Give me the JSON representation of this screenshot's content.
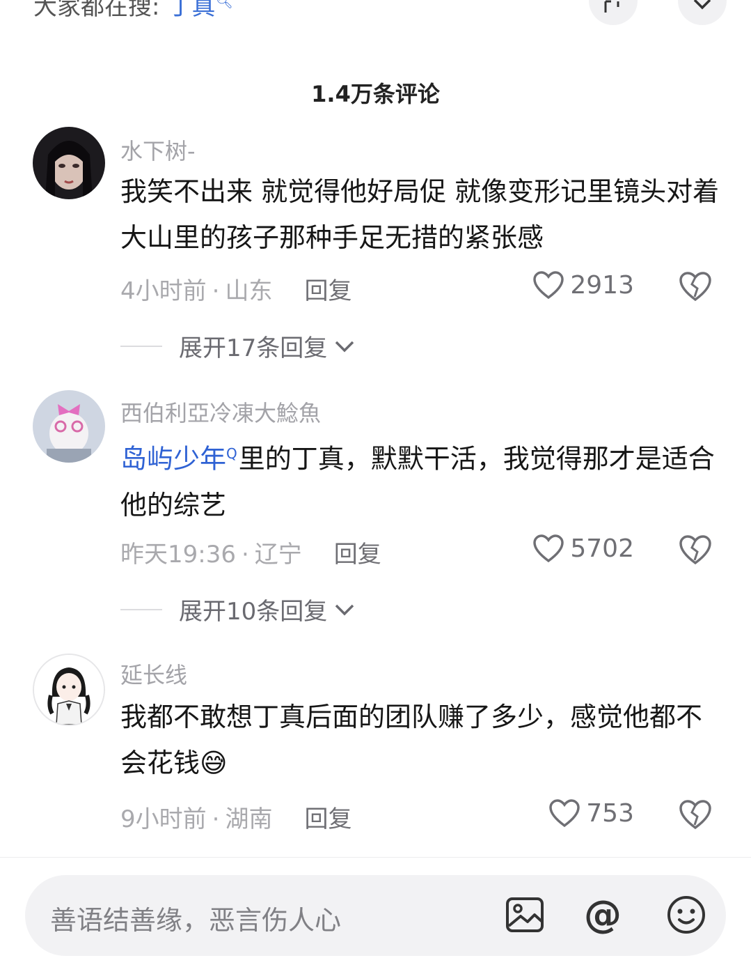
{
  "topbar": {
    "search_hint_prefix": "大家都在搜:",
    "search_term": "丁真"
  },
  "comment_count": "1.4万条评论",
  "comments": [
    {
      "username": "水下树-",
      "text": "我笑不出来 就觉得他好局促 就像变形记里镜头对着大山里的孩子那种手足无措的紧张感",
      "time": "4小时前",
      "location": "山东",
      "reply_label": "回复",
      "likes": "2913",
      "expand_label": "展开17条回复"
    },
    {
      "username": "西伯利亞冷凍大鯰魚",
      "link_text": "岛屿少年",
      "text": "里的丁真，默默干活，我觉得那才是适合他的综艺",
      "time": "昨天19:36",
      "location": "辽宁",
      "reply_label": "回复",
      "likes": "5702",
      "expand_label": "展开10条回复"
    },
    {
      "username": "延长线",
      "text": "我都不敢想丁真后面的团队赚了多少，感觉他都不会花钱",
      "emoji": "😅",
      "time": "9小时前",
      "location": "湖南",
      "reply_label": "回复",
      "likes": "753"
    }
  ],
  "input": {
    "placeholder": "善语结善缘，恶言伤人心",
    "at_symbol": "@"
  },
  "colors": {
    "link": "#2f62d4",
    "username": "#a3a3a8",
    "meta": "#a9a9ad"
  }
}
